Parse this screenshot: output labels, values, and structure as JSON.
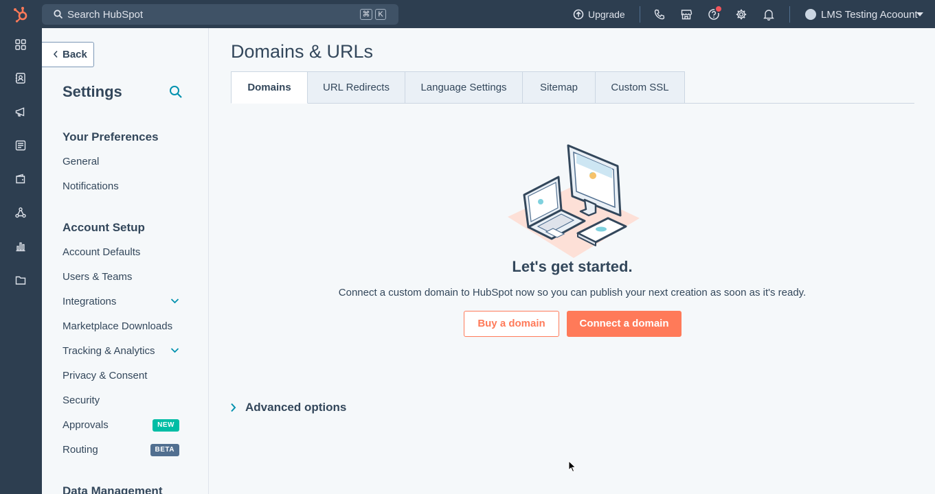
{
  "topbar": {
    "search_placeholder": "Search HubSpot",
    "kbd_cmd": "⌘",
    "kbd_k": "K",
    "upgrade_label": "Upgrade",
    "account_name": "LMS Testing Acoount"
  },
  "sidebar": {
    "back_label": "Back",
    "title": "Settings",
    "sections": [
      {
        "title": "Your Preferences",
        "items": [
          {
            "label": "General"
          },
          {
            "label": "Notifications"
          }
        ]
      },
      {
        "title": "Account Setup",
        "items": [
          {
            "label": "Account Defaults"
          },
          {
            "label": "Users & Teams"
          },
          {
            "label": "Integrations"
          },
          {
            "label": "Marketplace Downloads"
          },
          {
            "label": "Tracking & Analytics"
          },
          {
            "label": "Privacy & Consent"
          },
          {
            "label": "Security"
          },
          {
            "label": "Approvals",
            "badge": "NEW"
          },
          {
            "label": "Routing",
            "badge": "BETA"
          }
        ]
      },
      {
        "title": "Data Management",
        "items": []
      }
    ]
  },
  "main": {
    "title": "Domains & URLs",
    "tabs": [
      {
        "label": "Domains",
        "active": true
      },
      {
        "label": "URL Redirects"
      },
      {
        "label": "Language Settings"
      },
      {
        "label": "Sitemap"
      },
      {
        "label": "Custom SSL"
      }
    ],
    "empty_title": "Let's get started.",
    "empty_desc": "Connect a custom domain to HubSpot now so you can publish your next creation as soon as it's ready.",
    "buy_label": "Buy a domain",
    "connect_label": "Connect a domain",
    "advanced_label": "Advanced options"
  },
  "colors": {
    "nav_bg": "#2d3e50",
    "accent": "#ff7a59",
    "text": "#33475b",
    "new_badge": "#00bda5",
    "beta_badge": "#516f90"
  }
}
